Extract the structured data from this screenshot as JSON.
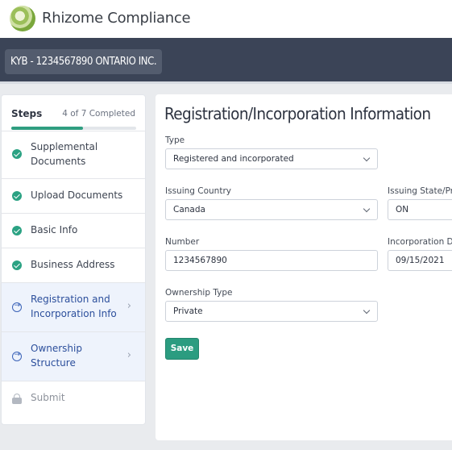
{
  "app": {
    "brand_name": "Rhizome Compliance",
    "kyb_label": "KYB - 1234567890 ONTARIO INC."
  },
  "steps": {
    "title": "Steps",
    "completed_label": "4 of 7 Completed",
    "progress": 0.571,
    "items": [
      {
        "label": "Supplemental Documents",
        "status": "completed"
      },
      {
        "label": "Upload Documents",
        "status": "completed"
      },
      {
        "label": "Basic Info",
        "status": "completed"
      },
      {
        "label": "Business Address",
        "status": "completed"
      },
      {
        "label": "Registration and Incorporation Info",
        "status": "current"
      },
      {
        "label": "Ownership Structure",
        "status": "current"
      },
      {
        "label": "Submit",
        "status": "locked"
      }
    ]
  },
  "form": {
    "title": "Registration/Incorporation Information",
    "type": {
      "label": "Type",
      "value": "Registered and incorporated"
    },
    "issuing_country": {
      "label": "Issuing Country",
      "value": "Canada"
    },
    "issuing_state": {
      "label": "Issuing State/Pro",
      "value": "ON"
    },
    "number": {
      "label": "Number",
      "value": "1234567890"
    },
    "incorporation_date": {
      "label": "Incorporation Da",
      "value": "09/15/2021"
    },
    "ownership_type": {
      "label": "Ownership Type",
      "value": "Private"
    },
    "save_label": "Save"
  },
  "colors": {
    "accent": "#2b9c80",
    "header_bg": "#3b4457",
    "active_step_bg": "#eef3fc",
    "active_step_text": "#2c4f9c"
  }
}
